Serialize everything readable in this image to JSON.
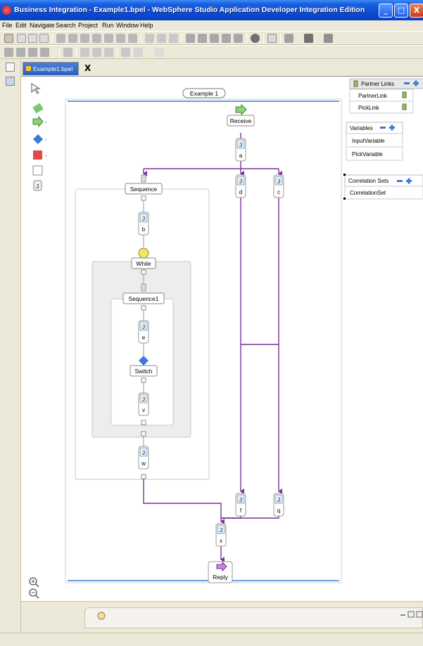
{
  "window": {
    "title": "Business Integration - Example1.bpel - WebSphere Studio Application Developer Integration Edition",
    "minimize": "_",
    "maximize": "□",
    "close": "X"
  },
  "menu": [
    "File",
    "Edit",
    "Navigate",
    "Search",
    "Project",
    "Run",
    "Window",
    "Help"
  ],
  "editor_tab": {
    "label": "Example1.bpel",
    "close": "X"
  },
  "process": {
    "title": "Example 1",
    "activities": {
      "receive": "Receive",
      "a": "a",
      "d": "d",
      "c": "c",
      "sequence": "Sequence",
      "b": "b",
      "while": "While",
      "sequence1": "Sequence1",
      "e": "e",
      "switch": "Switch",
      "v": "v",
      "w": "w",
      "f": "f",
      "q": "q",
      "x": "x",
      "reply": "Reply"
    },
    "java_glyph": "J"
  },
  "partner_links": {
    "header": "Partner Links",
    "items": [
      "PartnerLink",
      "PickLink"
    ]
  },
  "variables": {
    "header": "Variables",
    "items": [
      "InputVariable",
      "PickVariable"
    ]
  },
  "correlation_sets": {
    "header": "Correlation Sets",
    "items": [
      "CorrelationSet"
    ]
  },
  "colors": {
    "link": "#7b2f9b",
    "frame": "#c0c0c0",
    "title_bar": "#0c4cd4",
    "chrome": "#ece9d8"
  }
}
